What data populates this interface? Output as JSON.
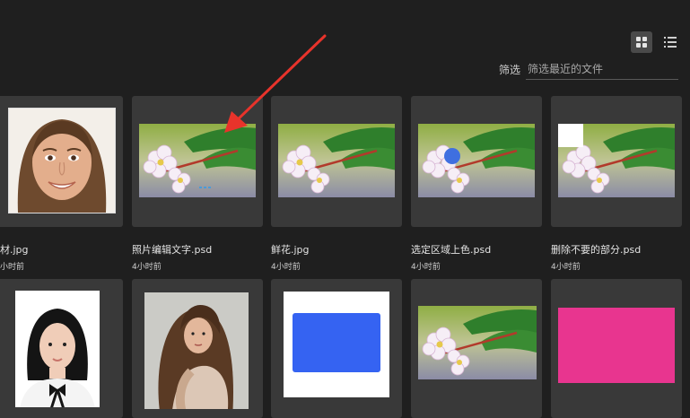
{
  "toolbar": {
    "grid_view_icon": "grid-icon",
    "list_view_icon": "list-icon"
  },
  "filter": {
    "label": "筛选",
    "placeholder": "筛选最近的文件"
  },
  "files": [
    {
      "name": "材.jpg",
      "time": "小时前",
      "thumb": "portrait-woman"
    },
    {
      "name": "照片编辑文字.psd",
      "time": "4小时前",
      "thumb": "flower"
    },
    {
      "name": "鲜花.jpg",
      "time": "4小时前",
      "thumb": "flower"
    },
    {
      "name": "选定区域上色.psd",
      "time": "4小时前",
      "thumb": "flower-blue-dot"
    },
    {
      "name": "删除不要的部分.psd",
      "time": "4小时前",
      "thumb": "flower-white-square"
    },
    {
      "name": "",
      "time": "",
      "thumb": "id-photo"
    },
    {
      "name": "",
      "time": "",
      "thumb": "curly-hair-woman"
    },
    {
      "name": "",
      "time": "",
      "thumb": "blue-rectangle"
    },
    {
      "name": "",
      "time": "",
      "thumb": "flower"
    },
    {
      "name": "",
      "time": "",
      "thumb": "pink-canvas"
    }
  ],
  "colors": {
    "background": "#1f1f1f",
    "card": "#393939",
    "annotation_arrow": "#e8332b",
    "blue_shape": "#3563f2",
    "pink_canvas": "#e8358f"
  }
}
